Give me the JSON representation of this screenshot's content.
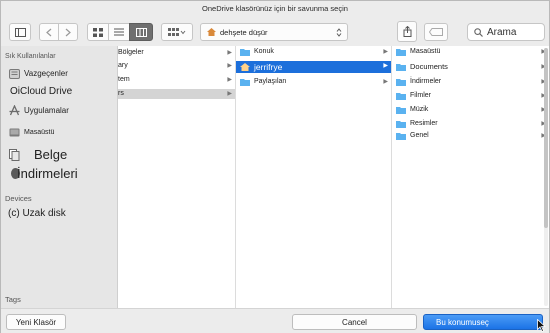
{
  "window": {
    "title": "OneDrive klasörünüz için bir savunma seçin"
  },
  "toolbar": {
    "location": "dehşete düşür",
    "search_placeholder": "Arama"
  },
  "sidebar": {
    "favorites_header": "Sık Kullanılanlar",
    "favorites": [
      {
        "label": "Vazgeçenler",
        "icon": "recents-icon"
      },
      {
        "label": "iCloud Drive",
        "prefix": "O",
        "icon": "icloud-icon"
      },
      {
        "label": "Uygulamalar",
        "icon": "applications-icon"
      },
      {
        "label": "Masaüstü",
        "icon": "desktop-icon"
      },
      {
        "label": "Belge",
        "icon": "documents-icon"
      },
      {
        "label": "İndirmeleri",
        "icon": "downloads-icon"
      }
    ],
    "devices_header": "Devices",
    "devices": [
      {
        "label": "(c) Uzak disk",
        "icon": "disk-icon"
      }
    ],
    "tags_header": "Tags"
  },
  "columns": {
    "col1": [
      "Bölgeler",
      "ary",
      "tem",
      "rs"
    ],
    "col2": [
      "Konuk",
      "jerrifrye",
      "Paylaşılan"
    ],
    "col3": [
      "Masaüstü",
      "Documents",
      "İndirmeler",
      "Filmler",
      "Müzik",
      "Resimler",
      "Genel"
    ]
  },
  "bottom": {
    "new_folder": "Yeni Klasör",
    "cancel": "Cancel",
    "choose": "Bu konumuseç"
  },
  "colors": {
    "accent": "#1c6fdb",
    "folder": "#5ab2f0"
  }
}
